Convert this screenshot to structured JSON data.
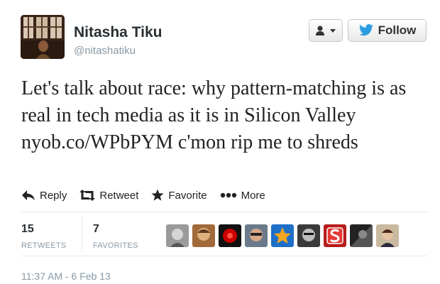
{
  "user": {
    "name": "Nitasha Tiku",
    "handle": "@nitashatiku"
  },
  "header_buttons": {
    "follow_label": "Follow"
  },
  "tweet": {
    "text_before_link": "Let's talk about race: why pattern-matching is as real in tech media as it is in Silicon Valley ",
    "link": "nyob.co/WPbPYM",
    "text_after_link": " c'mon rip me to shreds"
  },
  "actions": {
    "reply": "Reply",
    "retweet": "Retweet",
    "favorite": "Favorite",
    "more": "More"
  },
  "stats": {
    "retweets_count": "15",
    "retweets_label": "RETWEETS",
    "favorites_count": "7",
    "favorites_label": "FAVORITES"
  },
  "timestamp": "11:37 AM - 6 Feb 13",
  "colors": {
    "twitter_blue": "#2b9ce0",
    "muted_text": "#8899a6"
  }
}
